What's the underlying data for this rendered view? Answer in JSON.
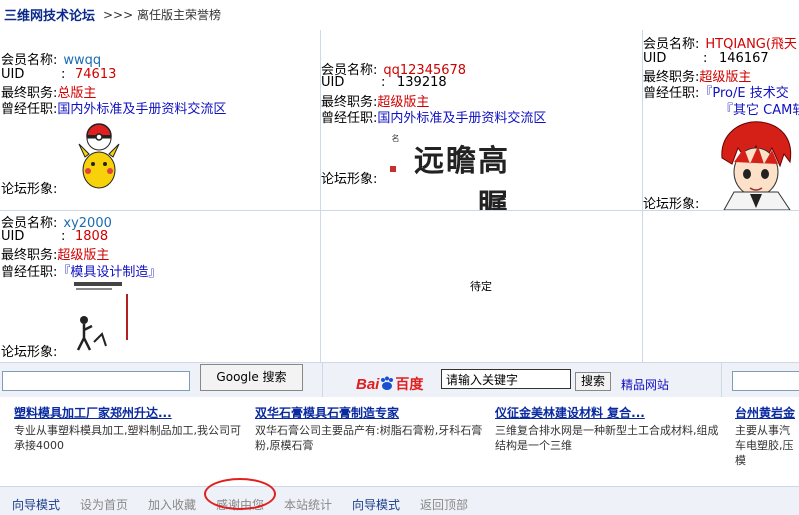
{
  "header": {
    "site_name": "三维网技术论坛",
    "breadcrumb": ">>> 离任版主荣誉榜"
  },
  "members": [
    {
      "name_label": "会员名称:",
      "name": "wwqq",
      "uid_label": "UID",
      "uid": "74613",
      "role_label": "最终职务:",
      "role": "总版主",
      "prev_label": "曾经任职:",
      "prev": [
        "国内外标准及手册资料交流区"
      ],
      "avatar_label": "论坛形象:",
      "avatar_icon": "pikachu-pokeball-icon"
    },
    {
      "name_label": "会员名称:",
      "name": "qq12345678",
      "uid_label": "UID",
      "uid": "139218",
      "role_label": "最终职务:",
      "role": "超级版主",
      "prev_label": "曾经任职:",
      "prev": [
        "国内外标准及手册资料交流区"
      ],
      "avatar_label": "论坛形象:",
      "avatar_text": "高瞻远瞩"
    },
    {
      "name_label": "会员名称:",
      "name": "HTQIANG(飛天",
      "uid_label": "UID",
      "uid": "146167",
      "role_label": "最终职务:",
      "role": "超级版主",
      "prev_label": "曾经任职:",
      "prev": [
        "『Pro/E 技术交",
        "『其它  CAM软"
      ],
      "avatar_label": "论坛形象:",
      "avatar_icon": "anime-character-icon"
    },
    {
      "name_label": "会员名称:",
      "name": "xy2000",
      "uid_label": "UID",
      "uid": "1808",
      "role_label": "最终职务:",
      "role": "超级版主",
      "prev_label": "曾经任职:",
      "prev": [
        "『模具设计制造』"
      ],
      "avatar_label": "论坛形象:",
      "avatar_icon": "stick-figure-icon"
    }
  ],
  "pending_label": "待定",
  "search": {
    "google_value": "",
    "google_button": "Google 搜索",
    "baidu_logo_a": "Bai",
    "baidu_logo_b": "百度",
    "baidu_value": "请输入关键字",
    "baidu_button": "搜索",
    "baidu_link": "精品网站",
    "third_value": ""
  },
  "ads": [
    {
      "title": "塑料模具加工厂家郑州升达...",
      "desc": "专业从事塑料模具加工,塑料制品加工,我公司可承接4000"
    },
    {
      "title": "双华石膏模具石膏制造专家",
      "desc": "双华石膏公司主要品产有:树脂石膏粉,牙科石膏粉,原模石膏"
    },
    {
      "title": "仪征金美林建设材料  复合...",
      "desc": "三维复合排水网是一种新型土工合成材料,组成结构是一个三维"
    },
    {
      "title": "台州黄岩金",
      "desc": "主要从事汽车电塑胶,压模"
    }
  ],
  "footer": {
    "links": [
      "向导模式",
      "设为首页",
      "加入收藏",
      "感谢由您",
      "本站统计",
      "向导模式",
      "返回顶部"
    ]
  },
  "colors": {
    "link_blue": "#1010c0",
    "value_red": "#d00000",
    "name_blue": "#1a6bb5",
    "highlight_circle": "#e02020"
  }
}
